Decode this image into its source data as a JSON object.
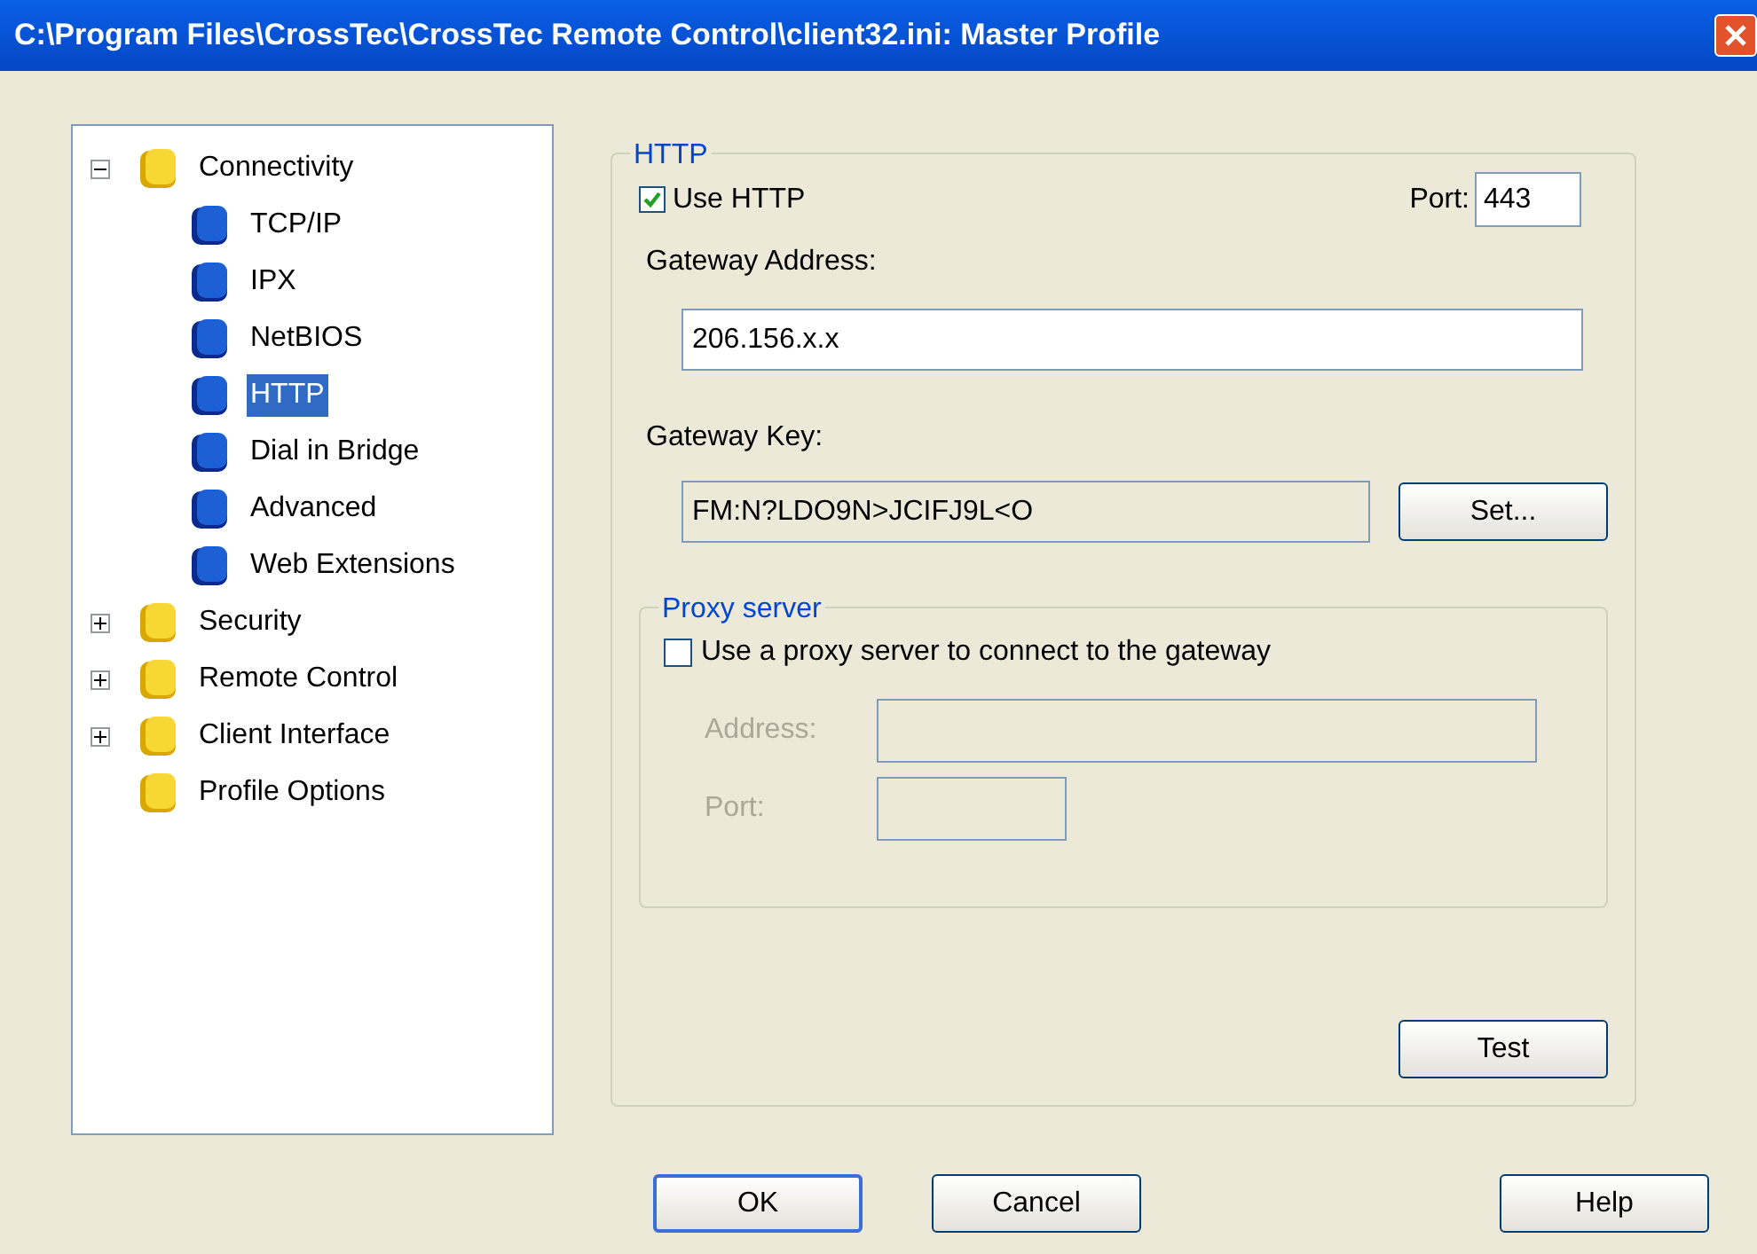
{
  "window": {
    "title": "C:\\Program Files\\CrossTec\\CrossTec Remote Control\\client32.ini: Master Profile"
  },
  "tree": [
    {
      "label": "Connectivity",
      "expanded": true,
      "selected": false,
      "children": [
        {
          "label": "TCP/IP",
          "selected": false
        },
        {
          "label": "IPX",
          "selected": false
        },
        {
          "label": "NetBIOS",
          "selected": false
        },
        {
          "label": "HTTP",
          "selected": true
        },
        {
          "label": "Dial in Bridge",
          "selected": false
        },
        {
          "label": "Advanced",
          "selected": false
        },
        {
          "label": "Web Extensions",
          "selected": false
        }
      ]
    },
    {
      "label": "Security",
      "expanded": false,
      "selected": false
    },
    {
      "label": "Remote Control",
      "expanded": false,
      "selected": false
    },
    {
      "label": "Client Interface",
      "expanded": false,
      "selected": false
    },
    {
      "label": "Profile Options",
      "selected": false
    }
  ],
  "http": {
    "legend": "HTTP",
    "use_http": {
      "label": "Use HTTP",
      "checked": true
    },
    "port_label": "Port:",
    "port": "443",
    "gateway_address_label": "Gateway Address:",
    "gateway_address": "206.156.x.x",
    "gateway_key_label": "Gateway Key:",
    "gateway_key": "FM:N?LDO9N>JCIFJ9L<O",
    "set_button": "Set...",
    "proxy": {
      "legend": "Proxy server",
      "use_proxy": {
        "label": "Use a proxy server to connect to the gateway",
        "checked": false
      },
      "address_label": "Address:",
      "port_label": "Port:",
      "disabled": true
    },
    "test_button": "Test"
  },
  "buttons": [
    {
      "label": "OK",
      "default": true
    },
    {
      "label": "Cancel",
      "default": false
    },
    {
      "label": "Help",
      "default": false
    }
  ]
}
